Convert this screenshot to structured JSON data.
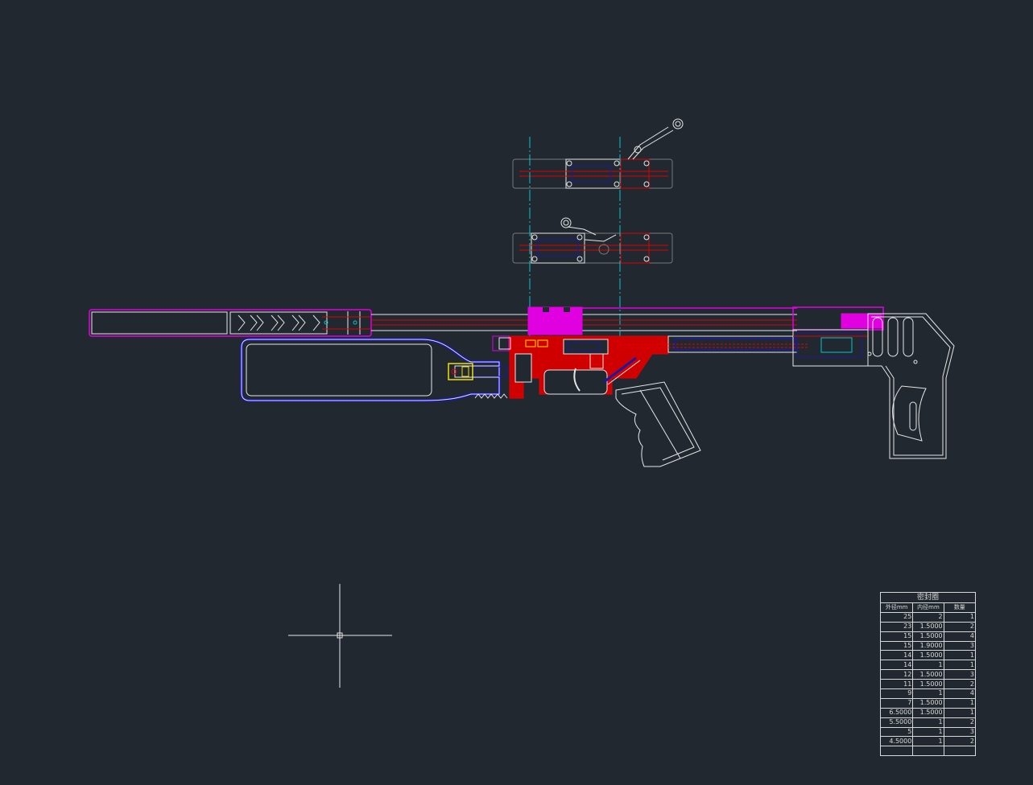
{
  "background": "#212830",
  "colors": {
    "outline": "#e6e6e6",
    "section_red": "#e00000",
    "magenta": "#e000e0",
    "blue": "#1a1aa0",
    "cyan": "#00c8d0",
    "yellow": "#f0e000"
  },
  "seal_table": {
    "title": "密封圈",
    "headers": [
      "外径mm",
      "内径mm",
      "数量"
    ],
    "rows": [
      [
        "25",
        "2",
        "1"
      ],
      [
        "23",
        "1.5000",
        "2"
      ],
      [
        "15",
        "1.5000",
        "4"
      ],
      [
        "15",
        "1.9000",
        "3"
      ],
      [
        "14",
        "1.5000",
        "1"
      ],
      [
        "14",
        "1",
        "1"
      ],
      [
        "12",
        "1.5000",
        "3"
      ],
      [
        "11",
        "1.5000",
        "2"
      ],
      [
        "9",
        "1",
        "4"
      ],
      [
        "7",
        "1.5000",
        "1"
      ],
      [
        "6.5000",
        "1.5000",
        "1"
      ],
      [
        "5.5000",
        "1",
        "2"
      ],
      [
        "5",
        "1",
        "3"
      ],
      [
        "4.5000",
        "1",
        "2"
      ],
      [
        "",
        "",
        ""
      ]
    ]
  },
  "icons": [
    "ucs-crosshair-icon"
  ]
}
